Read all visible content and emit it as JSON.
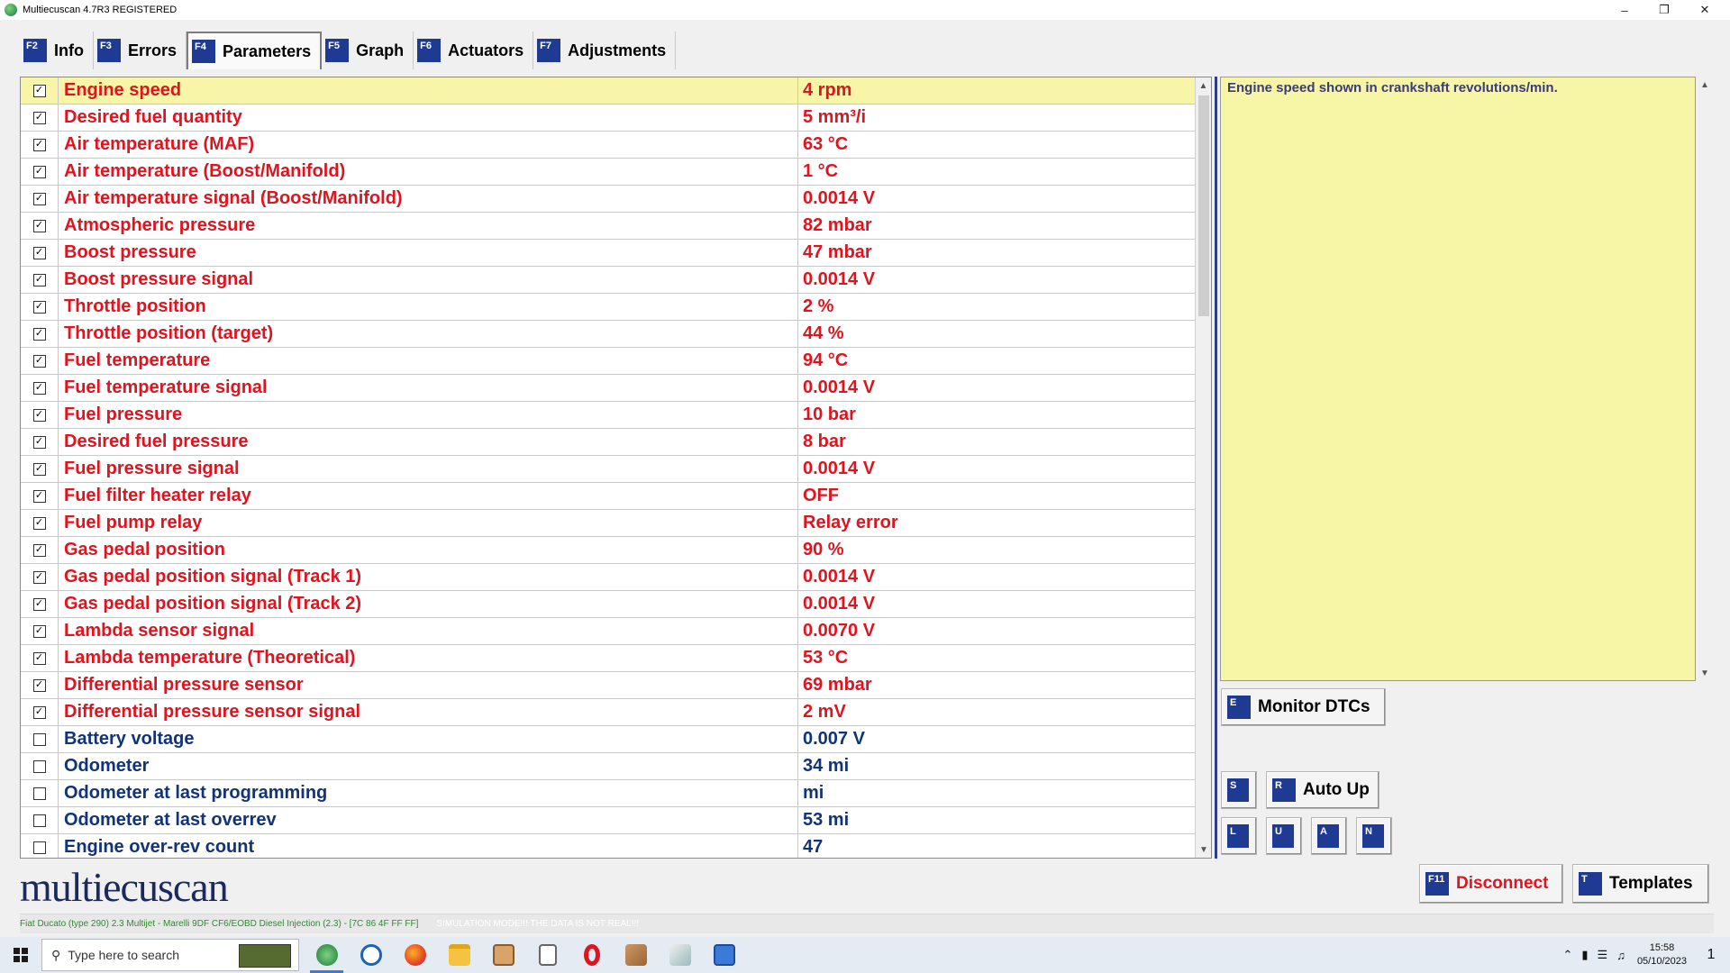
{
  "window": {
    "title": "Multiecuscan 4.7R3 REGISTERED",
    "minimize": "–",
    "restore": "❐",
    "close": "✕"
  },
  "tabs": [
    {
      "key": "F2",
      "label": "Info"
    },
    {
      "key": "F3",
      "label": "Errors"
    },
    {
      "key": "F4",
      "label": "Parameters"
    },
    {
      "key": "F5",
      "label": "Graph"
    },
    {
      "key": "F6",
      "label": "Actuators"
    },
    {
      "key": "F7",
      "label": "Adjustments"
    }
  ],
  "active_tab": "Parameters",
  "parameters": [
    {
      "name": "Engine speed",
      "value": "4 rpm",
      "checked": true,
      "selected": true
    },
    {
      "name": "Desired fuel quantity",
      "value": "5 mm³/i",
      "checked": true
    },
    {
      "name": "Air temperature (MAF)",
      "value": "63 °C",
      "checked": true
    },
    {
      "name": "Air temperature (Boost/Manifold)",
      "value": "1 °C",
      "checked": true
    },
    {
      "name": "Air temperature signal (Boost/Manifold)",
      "value": "0.0014 V",
      "checked": true
    },
    {
      "name": "Atmospheric pressure",
      "value": "82 mbar",
      "checked": true
    },
    {
      "name": "Boost pressure",
      "value": "47 mbar",
      "checked": true
    },
    {
      "name": "Boost pressure signal",
      "value": "0.0014 V",
      "checked": true
    },
    {
      "name": "Throttle position",
      "value": "2 %",
      "checked": true
    },
    {
      "name": "Throttle position (target)",
      "value": "44 %",
      "checked": true
    },
    {
      "name": "Fuel temperature",
      "value": "94 °C",
      "checked": true
    },
    {
      "name": "Fuel temperature signal",
      "value": "0.0014 V",
      "checked": true
    },
    {
      "name": "Fuel pressure",
      "value": "10 bar",
      "checked": true
    },
    {
      "name": "Desired fuel pressure",
      "value": "8 bar",
      "checked": true
    },
    {
      "name": "Fuel pressure signal",
      "value": "0.0014 V",
      "checked": true
    },
    {
      "name": "Fuel filter heater relay",
      "value": "OFF",
      "checked": true
    },
    {
      "name": "Fuel pump relay",
      "value": "Relay error",
      "checked": true
    },
    {
      "name": "Gas pedal position",
      "value": "90 %",
      "checked": true
    },
    {
      "name": "Gas pedal position signal (Track 1)",
      "value": "0.0014 V",
      "checked": true
    },
    {
      "name": "Gas pedal position signal (Track 2)",
      "value": "0.0014 V",
      "checked": true
    },
    {
      "name": "Lambda sensor signal",
      "value": "0.0070 V",
      "checked": true
    },
    {
      "name": "Lambda temperature (Theoretical)",
      "value": "53 °C",
      "checked": true
    },
    {
      "name": "Differential pressure sensor",
      "value": "69 mbar",
      "checked": true
    },
    {
      "name": "Differential pressure sensor signal",
      "value": "2 mV",
      "checked": true
    },
    {
      "name": "Battery voltage",
      "value": "0.007 V",
      "checked": false
    },
    {
      "name": "Odometer",
      "value": "34 mi",
      "checked": false
    },
    {
      "name": "Odometer at last programming",
      "value": " mi",
      "checked": false
    },
    {
      "name": "Odometer at last overrev",
      "value": "53 mi",
      "checked": false
    },
    {
      "name": "Engine over-rev count",
      "value": "47",
      "checked": false
    }
  ],
  "description": "Engine speed shown in crankshaft revolutions/min.",
  "buttons": {
    "monitor_dtcs": {
      "key": "E",
      "label": "Monitor DTCs"
    },
    "s": {
      "key": "S"
    },
    "auto_up": {
      "key": "R",
      "label": "Auto Up"
    },
    "l": {
      "key": "L"
    },
    "u": {
      "key": "U"
    },
    "a": {
      "key": "A"
    },
    "n": {
      "key": "N"
    },
    "disconnect": {
      "key": "F11",
      "label": "Disconnect"
    },
    "templates": {
      "key": "T",
      "label": "Templates"
    }
  },
  "logo_text": "multiecuscan",
  "status": {
    "vehicle": "Fiat Ducato (type 290) 2.3 Multijet - Marelli 9DF CF6/EOBD Diesel Injection (2.3) - [7C 86 4F FF FF]",
    "simulation": "SIMULATION MODE!!! THE DATA IS NOT REAL!!!"
  },
  "taskbar": {
    "search_placeholder": "Type here to search",
    "time": "15:58",
    "date": "05/10/2023",
    "notifications": "1"
  },
  "colors": {
    "checked_text": "#e0141e",
    "unchecked_text": "#11337a",
    "selected_row": "#f8f5a8",
    "key_badge": "#1f3a93"
  }
}
